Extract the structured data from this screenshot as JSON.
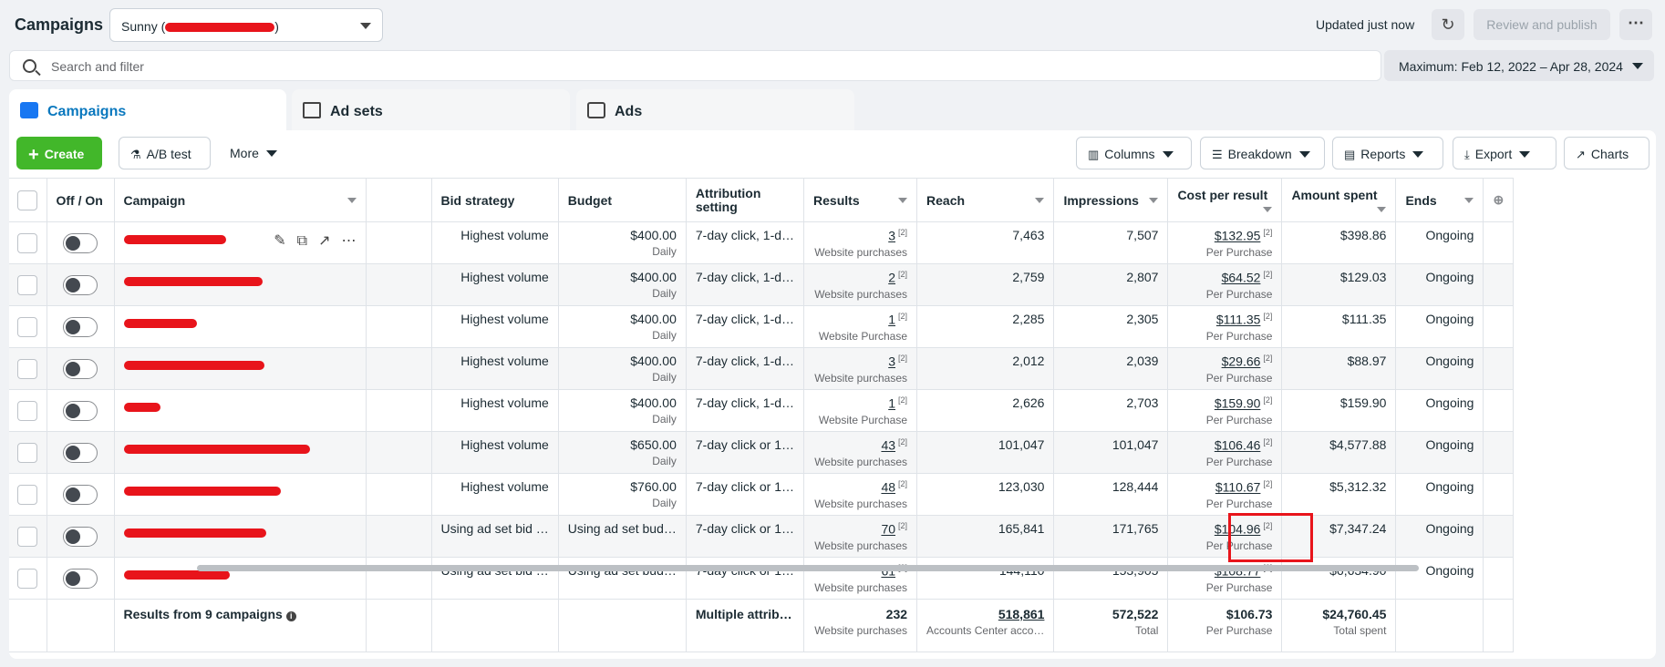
{
  "header": {
    "title": "Campaigns",
    "account": "Sunny (",
    "account_suffix": ")",
    "updated": "Updated just now",
    "review_label": "Review and publish",
    "more_icon": "⋯"
  },
  "search": {
    "placeholder": "Search and filter"
  },
  "date_range": "Maximum: Feb 12, 2022 – Apr 28, 2024",
  "tabs": [
    {
      "label": "Campaigns"
    },
    {
      "label": "Ad sets"
    },
    {
      "label": "Ads"
    }
  ],
  "toolbar": {
    "create": "Create",
    "ab_test": "A/B test",
    "more": "More",
    "columns": "Columns",
    "breakdown": "Breakdown",
    "reports": "Reports",
    "export": "Export",
    "charts": "Charts"
  },
  "columns": {
    "offon": "Off / On",
    "campaign": "Campaign",
    "bid": "Bid strategy",
    "budget": "Budget",
    "attribution": "Attribution setting",
    "results": "Results",
    "reach": "Reach",
    "impressions": "Impressions",
    "cpr": "Cost per result",
    "spent": "Amount spent",
    "ends": "Ends"
  },
  "rows": [
    {
      "bid": "Highest volume",
      "budget": "$400.00",
      "budget_sub": "Daily",
      "attribution": "7-day click, 1-d…",
      "results": "3",
      "results_sub": "Website purchases",
      "reach": "7,463",
      "impressions": "7,507",
      "cpr": "$132.95",
      "cpr_sub": "Per Purchase",
      "spent": "$398.86",
      "ends": "Ongoing"
    },
    {
      "bid": "Highest volume",
      "budget": "$400.00",
      "budget_sub": "Daily",
      "attribution": "7-day click, 1-d…",
      "results": "2",
      "results_sub": "Website purchases",
      "reach": "2,759",
      "impressions": "2,807",
      "cpr": "$64.52",
      "cpr_sub": "Per Purchase",
      "spent": "$129.03",
      "ends": "Ongoing"
    },
    {
      "bid": "Highest volume",
      "budget": "$400.00",
      "budget_sub": "Daily",
      "attribution": "7-day click, 1-d…",
      "results": "1",
      "results_sub": "Website Purchase",
      "reach": "2,285",
      "impressions": "2,305",
      "cpr": "$111.35",
      "cpr_sub": "Per Purchase",
      "spent": "$111.35",
      "ends": "Ongoing"
    },
    {
      "bid": "Highest volume",
      "budget": "$400.00",
      "budget_sub": "Daily",
      "attribution": "7-day click, 1-d…",
      "results": "3",
      "results_sub": "Website purchases",
      "reach": "2,012",
      "impressions": "2,039",
      "cpr": "$29.66",
      "cpr_sub": "Per Purchase",
      "spent": "$88.97",
      "ends": "Ongoing"
    },
    {
      "bid": "Highest volume",
      "budget": "$400.00",
      "budget_sub": "Daily",
      "attribution": "7-day click, 1-d…",
      "results": "1",
      "results_sub": "Website Purchase",
      "reach": "2,626",
      "impressions": "2,703",
      "cpr": "$159.90",
      "cpr_sub": "Per Purchase",
      "spent": "$159.90",
      "ends": "Ongoing"
    },
    {
      "bid": "Highest volume",
      "budget": "$650.00",
      "budget_sub": "Daily",
      "attribution": "7-day click or 1…",
      "results": "43",
      "results_sub": "Website purchases",
      "reach": "101,047",
      "impressions": "101,047",
      "cpr": "$106.46",
      "cpr_sub": "Per Purchase",
      "spent": "$4,577.88",
      "ends": "Ongoing"
    },
    {
      "bid": "Highest volume",
      "budget": "$760.00",
      "budget_sub": "Daily",
      "attribution": "7-day click or 1…",
      "results": "48",
      "results_sub": "Website purchases",
      "reach": "123,030",
      "impressions": "128,444",
      "cpr": "$110.67",
      "cpr_sub": "Per Purchase",
      "spent": "$5,312.32",
      "ends": "Ongoing"
    },
    {
      "bid": "Using ad set bid …",
      "budget": "Using ad set bud…",
      "budget_sub": "",
      "attribution": "7-day click or 1…",
      "results": "70",
      "results_sub": "Website purchases",
      "reach": "165,841",
      "impressions": "171,765",
      "cpr": "$104.96",
      "cpr_sub": "Per Purchase",
      "spent": "$7,347.24",
      "ends": "Ongoing"
    },
    {
      "bid": "Using ad set bid …",
      "budget": "Using ad set bud…",
      "budget_sub": "",
      "attribution": "7-day click or 1…",
      "results": "61",
      "results_sub": "Website purchases",
      "reach": "144,110",
      "impressions": "153,905",
      "cpr": "$108.77",
      "cpr_sub": "Per Purchase",
      "spent": "$6,634.90",
      "ends": "Ongoing"
    }
  ],
  "sup_mark": "[2]",
  "summary": {
    "label": "Results from 9 campaigns",
    "attribution": "Multiple attrib…",
    "results": "232",
    "results_sub": "Website purchases",
    "reach": "518,861",
    "reach_sub": "Accounts Center acco…",
    "impressions": "572,522",
    "impressions_sub": "Total",
    "cpr": "$106.73",
    "cpr_sub": "Per Purchase",
    "spent": "$24,760.45",
    "spent_sub": "Total spent"
  },
  "colors": {
    "accent": "#0a78be",
    "create": "#42b72a",
    "redaction": "#e8141b"
  }
}
